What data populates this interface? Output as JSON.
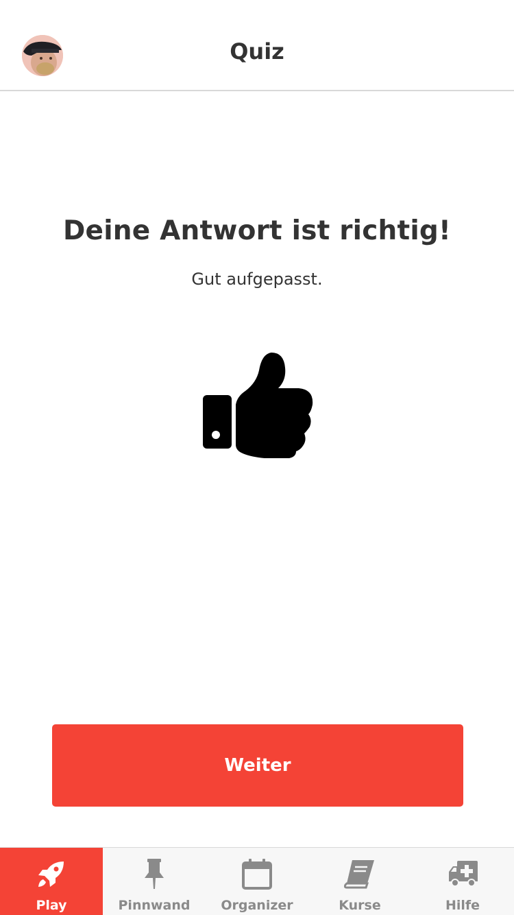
{
  "header": {
    "title": "Quiz",
    "avatar_icon": "user-avatar"
  },
  "result": {
    "title": "Deine Antwort ist richtig!",
    "subtitle": "Gut aufgepasst.",
    "icon": "thumbs-up-icon"
  },
  "actions": {
    "continue_label": "Weiter"
  },
  "tabs": [
    {
      "label": "Play",
      "icon": "rocket-icon",
      "active": true
    },
    {
      "label": "Pinnwand",
      "icon": "pushpin-icon",
      "active": false
    },
    {
      "label": "Organizer",
      "icon": "calendar-icon",
      "active": false
    },
    {
      "label": "Kurse",
      "icon": "book-icon",
      "active": false
    },
    {
      "label": "Hilfe",
      "icon": "ambulance-icon",
      "active": false
    }
  ],
  "colors": {
    "accent": "#f44336",
    "text": "#333333",
    "tab_inactive": "#8a8a8a",
    "tabbar_bg": "#f7f7f7"
  }
}
